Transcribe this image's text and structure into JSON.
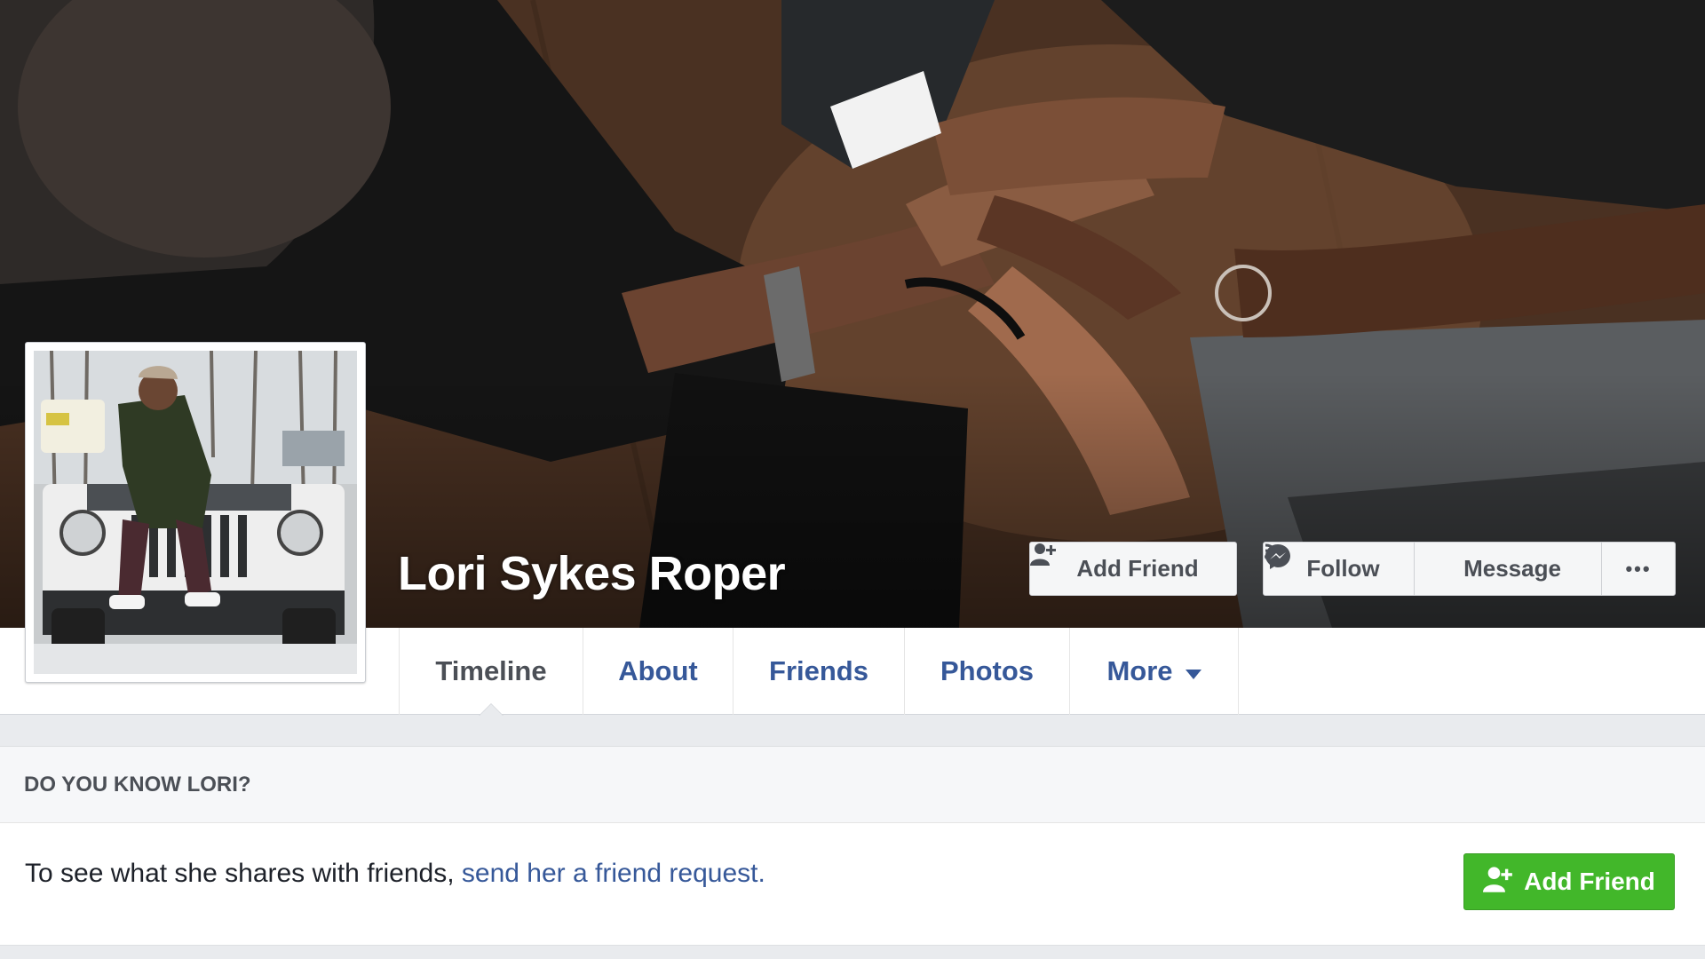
{
  "profile": {
    "name": "Lori Sykes Roper"
  },
  "cover_actions": {
    "add_friend": "Add Friend",
    "follow": "Follow",
    "message": "Message",
    "more": "•••"
  },
  "nav": {
    "tabs": [
      {
        "label": "Timeline",
        "active": true
      },
      {
        "label": "About"
      },
      {
        "label": "Friends"
      },
      {
        "label": "Photos"
      },
      {
        "label": "More"
      }
    ]
  },
  "know_panel": {
    "heading": "DO YOU KNOW LORI?",
    "text": "To see what she shares with friends, ",
    "link": "send her a friend request.",
    "button": "Add Friend"
  },
  "colors": {
    "link_blue": "#365899",
    "green": "#42b72a",
    "background": "#e9ebee"
  }
}
